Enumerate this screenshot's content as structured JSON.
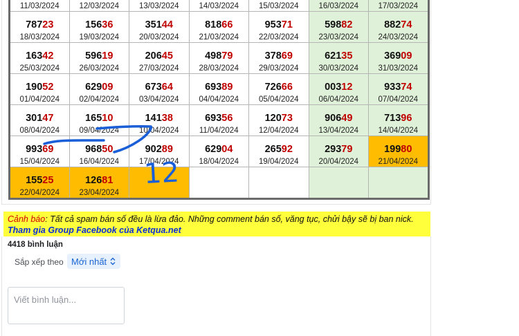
{
  "calendar": {
    "rows": [
      [
        {
          "date": "11/03/2024",
          "head": "",
          "tail": "",
          "style": ""
        },
        {
          "date": "12/03/2024",
          "head": "",
          "tail": "",
          "style": ""
        },
        {
          "date": "13/03/2024",
          "head": "",
          "tail": "",
          "style": ""
        },
        {
          "date": "14/03/2024",
          "head": "",
          "tail": "",
          "style": ""
        },
        {
          "date": "15/03/2024",
          "head": "",
          "tail": "",
          "style": ""
        },
        {
          "date": "16/03/2024",
          "head": "",
          "tail": "",
          "style": "wk"
        },
        {
          "date": "17/03/2024",
          "head": "",
          "tail": "",
          "style": "wk"
        }
      ],
      [
        {
          "date": "18/03/2024",
          "head": "787",
          "tail": "23",
          "style": ""
        },
        {
          "date": "19/03/2024",
          "head": "156",
          "tail": "36",
          "style": ""
        },
        {
          "date": "20/03/2024",
          "head": "351",
          "tail": "44",
          "style": ""
        },
        {
          "date": "21/03/2024",
          "head": "818",
          "tail": "66",
          "style": ""
        },
        {
          "date": "22/03/2024",
          "head": "953",
          "tail": "71",
          "style": ""
        },
        {
          "date": "23/03/2024",
          "head": "598",
          "tail": "82",
          "style": "wk"
        },
        {
          "date": "24/03/2024",
          "head": "882",
          "tail": "74",
          "style": "wk"
        }
      ],
      [
        {
          "date": "25/03/2024",
          "head": "163",
          "tail": "42",
          "style": ""
        },
        {
          "date": "26/03/2024",
          "head": "596",
          "tail": "19",
          "style": ""
        },
        {
          "date": "27/03/2024",
          "head": "206",
          "tail": "45",
          "style": ""
        },
        {
          "date": "28/03/2024",
          "head": "498",
          "tail": "79",
          "style": ""
        },
        {
          "date": "29/03/2024",
          "head": "378",
          "tail": "69",
          "style": ""
        },
        {
          "date": "30/03/2024",
          "head": "621",
          "tail": "35",
          "style": "wk"
        },
        {
          "date": "31/03/2024",
          "head": "369",
          "tail": "09",
          "style": "wk"
        }
      ],
      [
        {
          "date": "01/04/2024",
          "head": "190",
          "tail": "52",
          "style": ""
        },
        {
          "date": "02/04/2024",
          "head": "629",
          "tail": "09",
          "style": ""
        },
        {
          "date": "03/04/2024",
          "head": "673",
          "tail": "64",
          "style": ""
        },
        {
          "date": "04/04/2024",
          "head": "693",
          "tail": "89",
          "style": ""
        },
        {
          "date": "05/04/2024",
          "head": "726",
          "tail": "66",
          "style": ""
        },
        {
          "date": "06/04/2024",
          "head": "003",
          "tail": "12",
          "style": "wk"
        },
        {
          "date": "07/04/2024",
          "head": "933",
          "tail": "74",
          "style": "wk"
        }
      ],
      [
        {
          "date": "08/04/2024",
          "head": "301",
          "tail": "47",
          "style": ""
        },
        {
          "date": "09/04/2024",
          "head": "165",
          "tail": "10",
          "style": ""
        },
        {
          "date": "10/04/2024",
          "head": "141",
          "tail": "38",
          "style": ""
        },
        {
          "date": "11/04/2024",
          "head": "693",
          "tail": "56",
          "style": ""
        },
        {
          "date": "12/04/2024",
          "head": "120",
          "tail": "73",
          "style": ""
        },
        {
          "date": "13/04/2024",
          "head": "906",
          "tail": "49",
          "style": "wk"
        },
        {
          "date": "14/04/2024",
          "head": "713",
          "tail": "96",
          "style": "wk"
        }
      ],
      [
        {
          "date": "15/04/2024",
          "head": "993",
          "tail": "69",
          "style": ""
        },
        {
          "date": "16/04/2024",
          "head": "968",
          "tail": "50",
          "style": ""
        },
        {
          "date": "17/04/2024",
          "head": "902",
          "tail": "89",
          "style": ""
        },
        {
          "date": "18/04/2024",
          "head": "629",
          "tail": "04",
          "style": ""
        },
        {
          "date": "19/04/2024",
          "head": "265",
          "tail": "92",
          "style": ""
        },
        {
          "date": "20/04/2024",
          "head": "293",
          "tail": "79",
          "style": "wk"
        },
        {
          "date": "21/04/2024",
          "head": "199",
          "tail": "80",
          "style": "hl"
        }
      ],
      [
        {
          "date": "22/04/2024",
          "head": "155",
          "tail": "25",
          "style": "hl"
        },
        {
          "date": "23/04/2024",
          "head": "126",
          "tail": "81",
          "style": "hl"
        },
        {
          "date": "",
          "head": "",
          "tail": "",
          "style": "hl"
        },
        {
          "date": "",
          "head": "",
          "tail": "",
          "style": ""
        },
        {
          "date": "",
          "head": "",
          "tail": "",
          "style": ""
        },
        {
          "date": "",
          "head": "",
          "tail": "",
          "style": "wk"
        },
        {
          "date": "",
          "head": "",
          "tail": "",
          "style": "wk"
        }
      ]
    ]
  },
  "handwriting": {
    "text": "12",
    "color": "#1a5fd8"
  },
  "notice": {
    "warn_label": "Cảnh báo",
    "warn_text": ": Tất cả spam bán số đều là lừa đảo. Những comment bán số, văng tục, chửi bậy sẽ bị ban nick.",
    "group_link": "Tham gia Group Facebook của Ketqua.net"
  },
  "comments": {
    "count_label": "4418 bình luận",
    "sort_label": "Sắp xếp theo",
    "sort_value": "Mới nhất",
    "input_placeholder": "Viết bình luận..."
  },
  "colors": {
    "weekend": "#e0f1d9",
    "highlight": "#ffbc00",
    "tail_red": "#c00000",
    "notice_bg": "#ffff3b",
    "link_blue": "#0a2fd6",
    "sort_blue": "#1a66d2"
  }
}
